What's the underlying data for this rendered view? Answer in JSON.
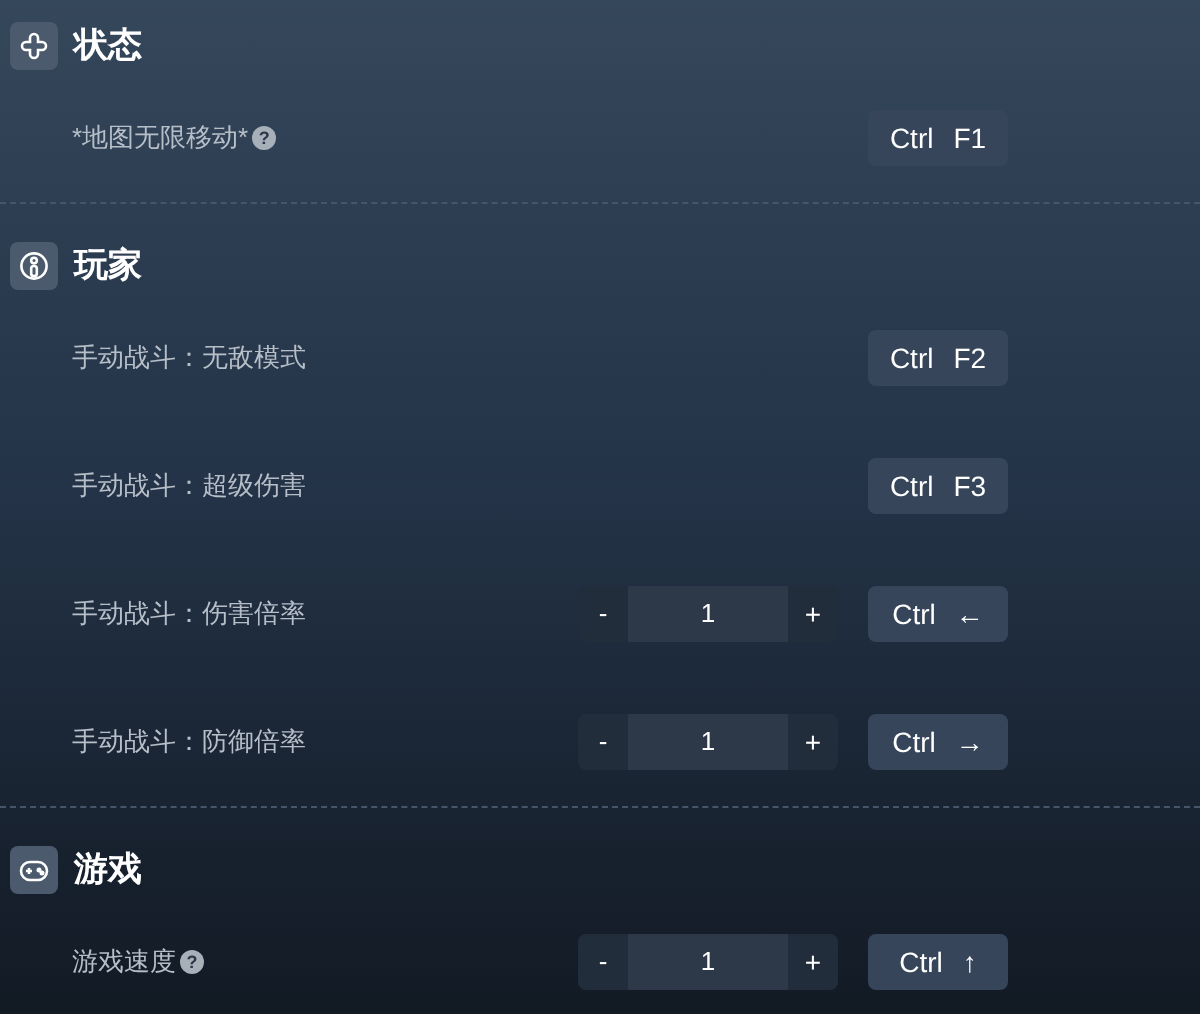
{
  "sections": [
    {
      "title": "状态",
      "kind": "status",
      "rows": [
        {
          "label": "*地图无限移动*",
          "help": "?",
          "keys": [
            "Ctrl",
            "F1"
          ]
        }
      ]
    },
    {
      "title": "玩家",
      "kind": "player",
      "rows": [
        {
          "label": "手动战斗：无敌模式",
          "keys": [
            "Ctrl",
            "F2"
          ]
        },
        {
          "label": "手动战斗：超级伤害",
          "keys": [
            "Ctrl",
            "F3"
          ]
        },
        {
          "label": "手动战斗：伤害倍率",
          "stepper": {
            "minus": "-",
            "value": "1",
            "plus": "+"
          },
          "keys": [
            "Ctrl",
            "←"
          ]
        },
        {
          "label": "手动战斗：防御倍率",
          "stepper": {
            "minus": "-",
            "value": "1",
            "plus": "+"
          },
          "keys": [
            "Ctrl",
            "→"
          ]
        }
      ]
    },
    {
      "title": "游戏",
      "kind": "game",
      "rows": [
        {
          "label": "游戏速度",
          "help": "?",
          "stepper": {
            "minus": "-",
            "value": "1",
            "plus": "+"
          },
          "keys": [
            "Ctrl",
            "↑"
          ]
        }
      ]
    }
  ]
}
